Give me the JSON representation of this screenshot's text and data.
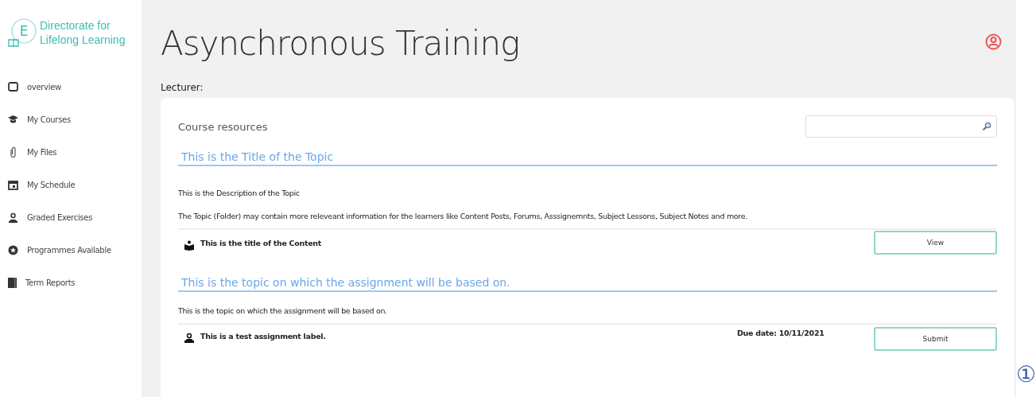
{
  "logo": {
    "letter": "E",
    "name_line1": "Directorate for",
    "name_line2": "Lifelong Learning"
  },
  "sidebar": {
    "items": [
      {
        "label": "overview"
      },
      {
        "label": "My Courses"
      },
      {
        "label": "My Files"
      },
      {
        "label": "My Schedule"
      },
      {
        "label": "Graded Exercises"
      },
      {
        "label": "Programmes Available"
      },
      {
        "label": "Term Reports"
      }
    ]
  },
  "page_title": "Asynchronous Training",
  "lecturer_label": "Lecturer:",
  "resources": {
    "heading": "Course resources",
    "topics": [
      {
        "title": "This is the Title of the Topic",
        "descriptions": [
          "This is the Description of the Topic",
          "The Topic (Folder) may contain more releveant information for the learners like Content Posts, Forums, Asssignemnts, Subject Lessons, Subject Notes and more."
        ],
        "items": [
          {
            "kind": "content",
            "label": "This is the title of the Content",
            "button": "View"
          }
        ]
      },
      {
        "title": "This is the topic on which the assignment will be based on.",
        "descriptions": [
          "This is the topic on which the assignment will be based on."
        ],
        "items": [
          {
            "kind": "assignment",
            "label": "This is a test assignment label.",
            "due": "Due date: 10/11/2021",
            "button": "Submit"
          }
        ]
      }
    ]
  },
  "annotation": "①"
}
